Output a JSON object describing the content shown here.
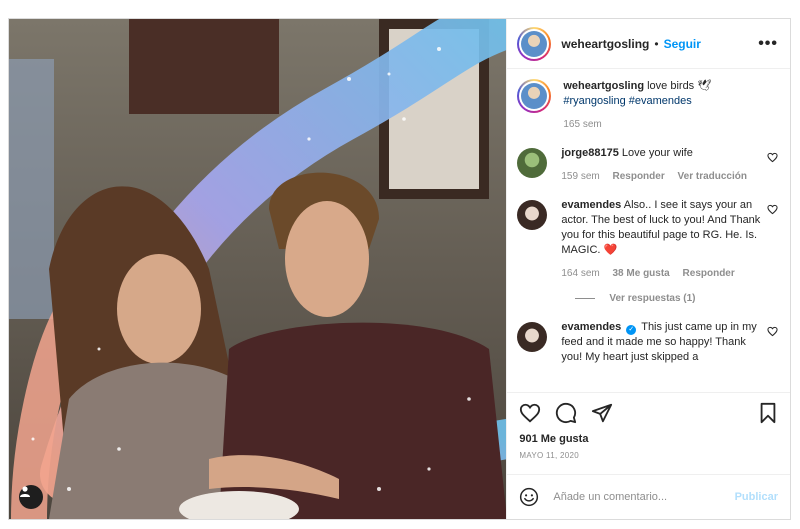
{
  "post": {
    "username": "weheartgosling",
    "follow_label": "Seguir",
    "more_label": "•••",
    "caption": {
      "username": "weheartgosling",
      "text": "love birds 🕊",
      "hashtags": "#ryangosling #evamendes",
      "time": "165 sem"
    },
    "comments": [
      {
        "username": "jorge88175",
        "text": "Love your wife",
        "time": "159 sem",
        "reply_label": "Responder",
        "translate_label": "Ver traducción"
      },
      {
        "username": "evamendes",
        "text": "Also.. I see it says your an actor. The best of luck to you! And Thank you for this beautiful page to RG. He. Is. MAGIC. ❤️",
        "time": "164 sem",
        "likes_label": "38 Me gusta",
        "reply_label": "Responder",
        "view_replies_label": "Ver respuestas (1)"
      },
      {
        "username": "evamendes",
        "text": "This just came up in my feed and it made me so happy! Thank you! My heart just skipped a"
      }
    ],
    "likes": "901 Me gusta",
    "date": "MAYO 11, 2020",
    "add_comment_placeholder": "Añade un comentario...",
    "publish_label": "Publicar"
  },
  "colors": {
    "accent": "#0095f6",
    "publish_disabled": "#b2dffc",
    "muted": "#8e8e8e",
    "heart": "#ed4956"
  },
  "icons": [
    "more-icon",
    "heart-icon",
    "comment-icon",
    "share-icon",
    "save-icon",
    "emoji-icon",
    "user-tag-icon",
    "verified-icon"
  ]
}
